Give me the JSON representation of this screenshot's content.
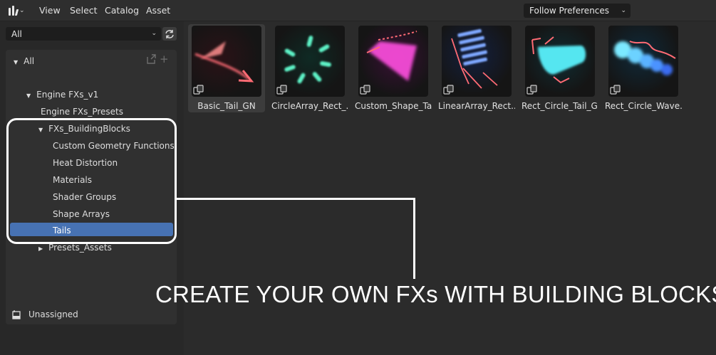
{
  "header": {
    "menus": [
      "View",
      "Select",
      "Catalog",
      "Asset"
    ],
    "library_dropdown": "Follow Preferences"
  },
  "sidebar": {
    "filter_value": "All",
    "tree": {
      "root": "All",
      "library": "Engine FXs_v1",
      "presets": "Engine FXs_Presets",
      "building_blocks": "FXs_BuildingBlocks",
      "children": [
        "Custom Geometry Functions",
        "Heat Distortion",
        "Materials",
        "Shader Groups",
        "Shape Arrays",
        "Tails"
      ],
      "presets_assets": "Presets_Assets"
    },
    "unassigned": "Unassigned"
  },
  "assets": [
    {
      "label": "Basic_Tail_GN",
      "icon": "basic-tail-thumbnail"
    },
    {
      "label": "CircleArray_Rect_...",
      "icon": "circle-array-thumbnail"
    },
    {
      "label": "Custom_Shape_Tail",
      "icon": "custom-shape-tail-thumbnail"
    },
    {
      "label": "LinearArray_Rect...",
      "icon": "linear-array-thumbnail"
    },
    {
      "label": "Rect_Circle_Tail_GN",
      "icon": "rect-circle-tail-thumbnail"
    },
    {
      "label": "Rect_Circle_Wave...",
      "icon": "rect-circle-wave-thumbnail"
    }
  ],
  "annotation": {
    "caption": "CREATE YOUR OWN FXs WITH BUILDING BLOCKS"
  },
  "colors": {
    "selection": "#4772b3",
    "background": "#2b2b2b",
    "callout": "#ffffff"
  }
}
